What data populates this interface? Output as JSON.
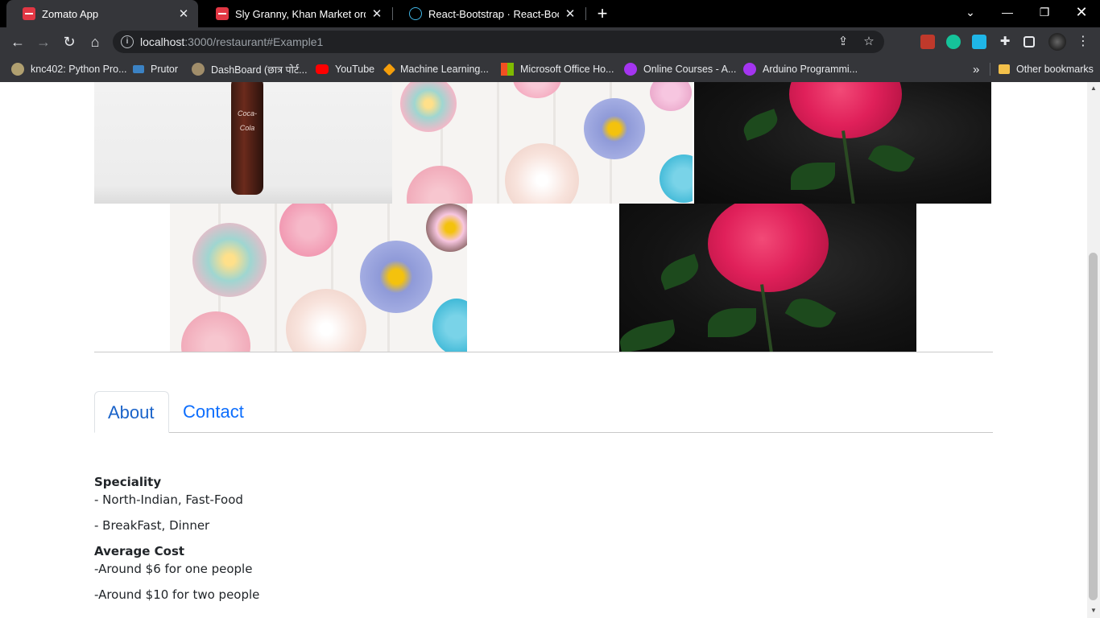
{
  "browser": {
    "tabs": [
      {
        "title": "Zomato App",
        "active": true
      },
      {
        "title": "Sly Granny, Khan Market order online",
        "active": false
      },
      {
        "title": "React-Bootstrap · React-Bootstrap",
        "active": false
      }
    ],
    "url_host": "localhost",
    "url_path": ":3000/restaurant#Example1",
    "bookmarks": [
      "knc402: Python Pro...",
      "Prutor",
      "DashBoard (छात्र पोर्ट...",
      "YouTube",
      "Machine Learning...",
      "Microsoft Office Ho...",
      "Online Courses - A...",
      "Arduino Programmi..."
    ],
    "other_bookmarks": "Other bookmarks",
    "more_chevron": "»"
  },
  "page": {
    "tabs": [
      "About",
      "Contact"
    ],
    "active_tab": "About",
    "speciality_heading": "Speciality",
    "speciality_items": [
      "- North-Indian, Fast-Food",
      "- BreakFast, Dinner"
    ],
    "cost_heading": "Average Cost",
    "cost_items": [
      "-Around $6 for one people",
      "-Around $10 for two people"
    ],
    "coke_label": "Coca-Cola"
  }
}
